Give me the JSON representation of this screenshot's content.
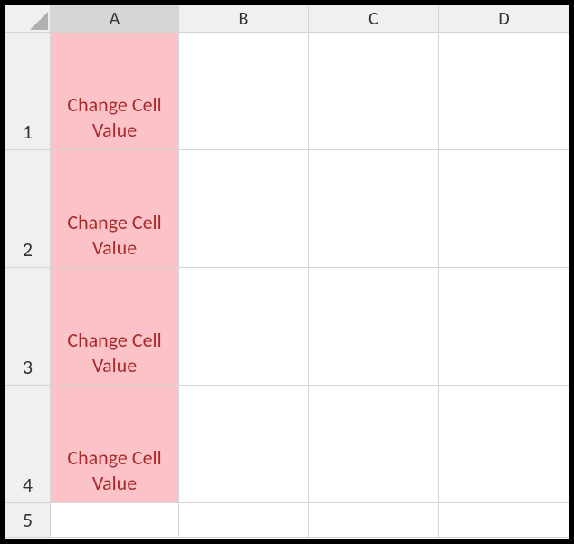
{
  "columns": {
    "a": "A",
    "b": "B",
    "c": "C",
    "d": "D"
  },
  "rows": {
    "r1": "1",
    "r2": "2",
    "r3": "3",
    "r4": "4",
    "r5": "5"
  },
  "cells": {
    "a1": "Change Cell Value",
    "a2": "Change Cell Value",
    "a3": "Change Cell Value",
    "a4": "Change Cell Value"
  },
  "highlight": {
    "column": "A",
    "background": "#fbc3c8",
    "text_color": "#a92a2a"
  }
}
